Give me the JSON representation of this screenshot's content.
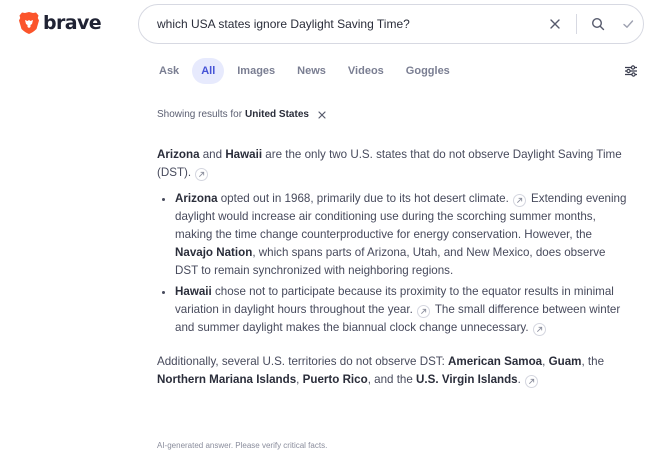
{
  "brand": {
    "name": "brave",
    "accent": "#fb542b"
  },
  "search": {
    "query": "which USA states ignore Daylight Saving Time?",
    "icons": [
      "close-icon",
      "search-icon",
      "check-icon"
    ]
  },
  "tabs": [
    {
      "label": "Ask",
      "active": false
    },
    {
      "label": "All",
      "active": true
    },
    {
      "label": "Images",
      "active": false
    },
    {
      "label": "News",
      "active": false
    },
    {
      "label": "Videos",
      "active": false
    },
    {
      "label": "Goggles",
      "active": false
    }
  ],
  "region": {
    "prefix": "Showing results for",
    "name": "United States"
  },
  "answer": {
    "intro": {
      "t1": "Arizona",
      "t2": " and ",
      "t3": "Hawaii",
      "t4": " are the only two U.S. states that do not observe Daylight Saving Time (DST)."
    },
    "bullet1": {
      "t1": "Arizona",
      "t2": " opted out in 1968, primarily due to its hot desert climate.",
      "t3": " Extending evening daylight would increase air conditioning use during the scorching summer months, making the time change counterproductive for energy conservation. However, the ",
      "t4": "Navajo Nation",
      "t5": ", which spans parts of Arizona, Utah, and New Mexico, does observe DST to remain synchronized with neighboring regions."
    },
    "bullet2": {
      "t1": "Hawaii",
      "t2": " chose not to participate because its proximity to the equator results in minimal variation in daylight hours throughout the year.",
      "t3": " The small difference between winter and summer daylight makes the biannual clock change unnecessary."
    },
    "extra": {
      "t1": "Additionally, several U.S. territories do not observe DST: ",
      "t2": "American Samoa",
      "t3": ", ",
      "t4": "Guam",
      "t5": ", the ",
      "t6": "Northern Mariana Islands",
      "t7": ", ",
      "t8": "Puerto Rico",
      "t9": ", and the ",
      "t10": "U.S. Virgin Islands",
      "t11": "."
    }
  },
  "disclaimer": "AI-generated answer. Please verify critical facts."
}
